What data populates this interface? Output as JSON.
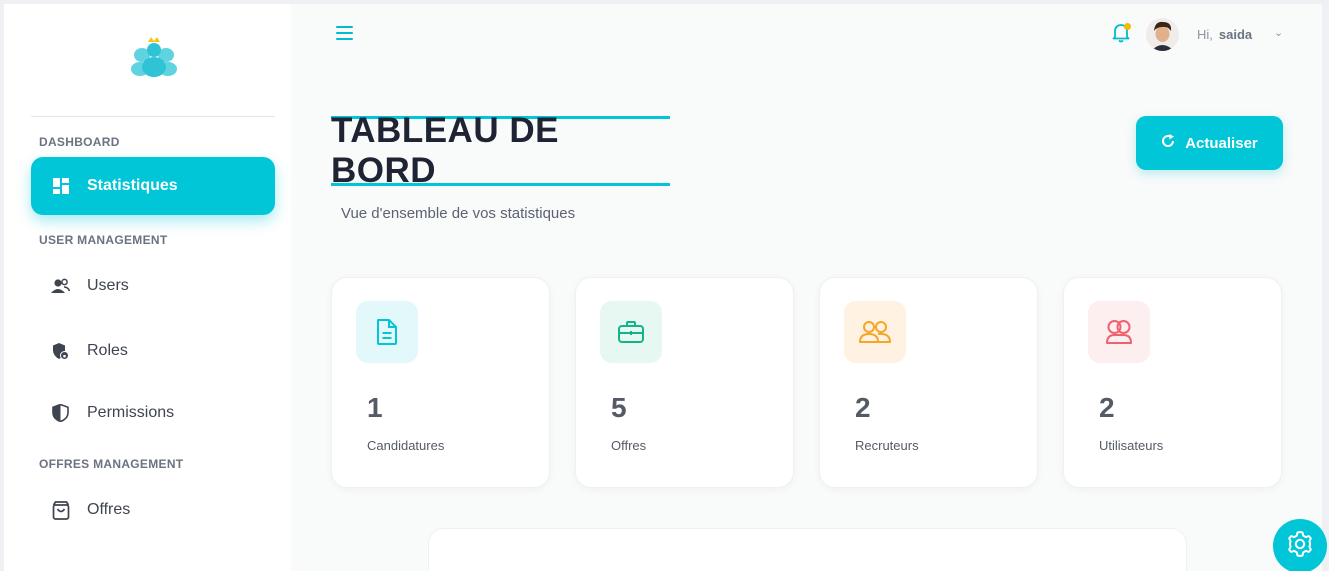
{
  "sidebar": {
    "sections": [
      "DASHBOARD",
      "USER MANAGEMENT",
      "OFFRES MANAGEMENT"
    ],
    "items": [
      {
        "label": "Statistiques",
        "icon": "dashboard-icon",
        "active": true
      },
      {
        "label": "Users",
        "icon": "users-icon"
      },
      {
        "label": "Roles",
        "icon": "shield-lock-icon"
      },
      {
        "label": "Permissions",
        "icon": "shield-icon"
      },
      {
        "label": "Offres",
        "icon": "shopping-bag-icon"
      }
    ]
  },
  "header": {
    "greeting": "Hi,",
    "username": "saida"
  },
  "page": {
    "title": "TABLEAU DE BORD",
    "subtitle": "Vue d'ensemble de vos statistiques",
    "refresh_label": "Actualiser"
  },
  "stats": [
    {
      "value": "1",
      "label": "Candidatures",
      "icon": "document-icon",
      "color": "#00c6d7",
      "bg": "#e3f8fa"
    },
    {
      "value": "5",
      "label": "Offres",
      "icon": "briefcase-icon",
      "color": "#14b48a",
      "bg": "#e6f8f1"
    },
    {
      "value": "2",
      "label": "Recruteurs",
      "icon": "users-icon",
      "color": "#f5a623",
      "bg": "#fff2e3"
    },
    {
      "value": "2",
      "label": "Utilisateurs",
      "icon": "user-group-icon",
      "color": "#f0616f",
      "bg": "#fdeef0"
    }
  ],
  "colors": {
    "accent": "#00c6d7",
    "notification_dot": "#f5b800",
    "title": "#1e2433"
  }
}
